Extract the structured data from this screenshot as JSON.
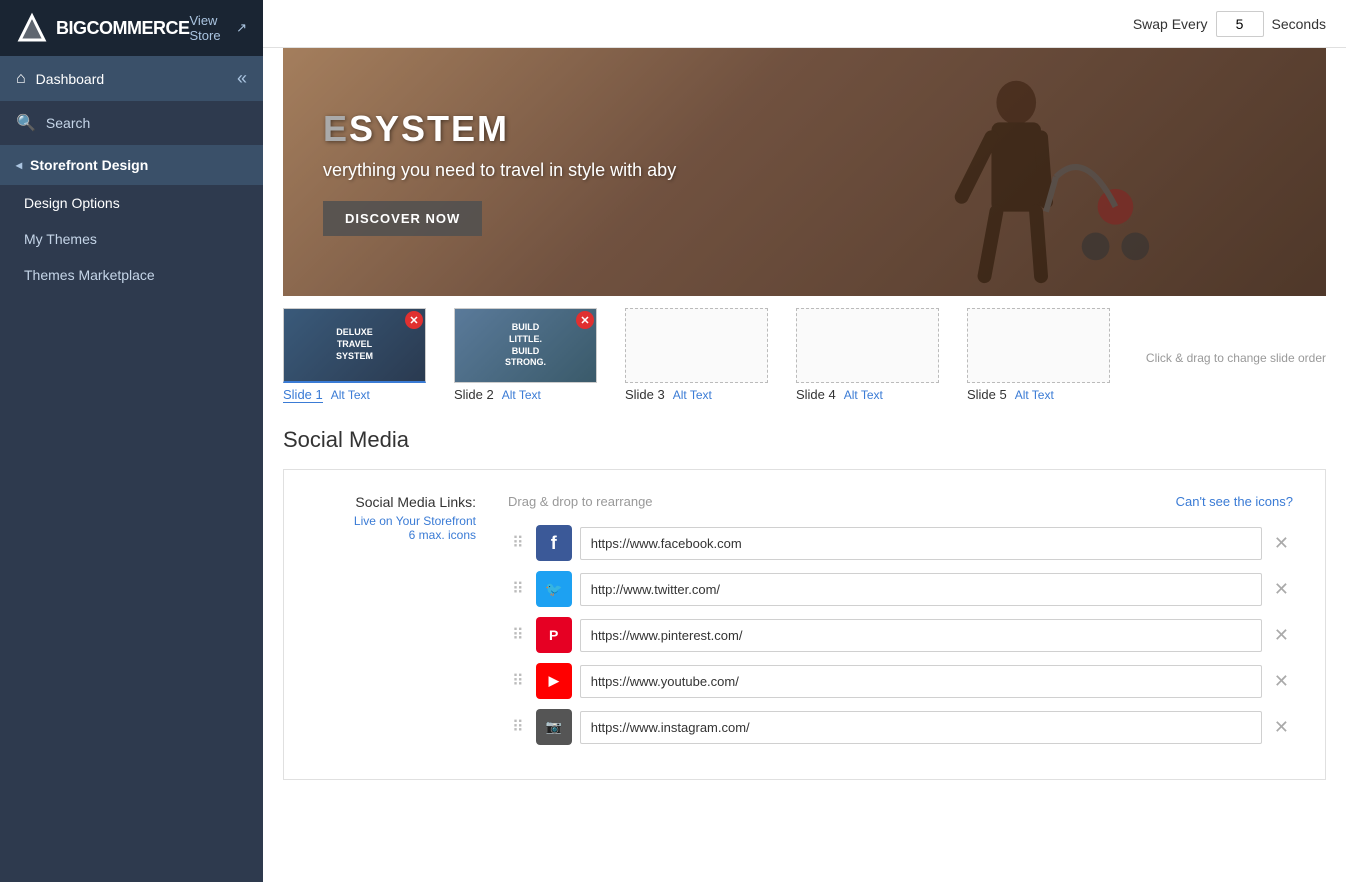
{
  "sidebar": {
    "logo": "BIGCOMMERCE",
    "view_store": "View Store",
    "nav_items": [
      {
        "id": "dashboard",
        "label": "Dashboard",
        "icon": "⌂",
        "active": true
      },
      {
        "id": "search",
        "label": "Search",
        "icon": "🔍",
        "active": false
      }
    ],
    "storefront_design": {
      "label": "Storefront Design",
      "sub_items": [
        {
          "id": "design-options",
          "label": "Design Options",
          "active": true
        },
        {
          "id": "my-themes",
          "label": "My Themes",
          "active": false
        },
        {
          "id": "themes-marketplace",
          "label": "Themes Marketplace",
          "active": false
        }
      ]
    }
  },
  "top_bar": {
    "swap_every_label": "Swap Every",
    "swap_value": "5",
    "seconds_label": "Seconds"
  },
  "slideshow": {
    "hero": {
      "title": "SYSTEM",
      "subtitle": "verything you need to travel in style with aby",
      "button_label": "DISCOVER NOW"
    },
    "drag_hint": "Click & drag to change slide order",
    "slides": [
      {
        "id": 1,
        "label": "Slide 1",
        "alt_text": "Alt Text",
        "active": true,
        "has_image": true,
        "thumb_text": "DELUXE\nTRAVEL\nSYSTEM"
      },
      {
        "id": 2,
        "label": "Slide 2",
        "alt_text": "Alt Text",
        "active": false,
        "has_image": true,
        "thumb_text": "BUILD\nLITTLE.\nBUILD\nSTRONG."
      },
      {
        "id": 3,
        "label": "Slide 3",
        "alt_text": "Alt Text",
        "active": false,
        "has_image": false
      },
      {
        "id": 4,
        "label": "Slide 4",
        "alt_text": "Alt Text",
        "active": false,
        "has_image": false
      },
      {
        "id": 5,
        "label": "Slide 5",
        "alt_text": "Alt Text",
        "active": false,
        "has_image": false
      }
    ]
  },
  "social_media": {
    "section_title": "Social Media",
    "links_label": "Social Media Links:",
    "live_label": "Live on Your Storefront",
    "max_label": "6 max. icons",
    "drag_hint": "Drag & drop to rearrange",
    "cant_see": "Can't see the icons?",
    "items": [
      {
        "id": "facebook",
        "platform": "facebook",
        "icon_char": "f",
        "url": "https://www.facebook.com",
        "color": "#3b5998"
      },
      {
        "id": "twitter",
        "platform": "twitter",
        "icon_char": "t",
        "url": "http://www.twitter.com/",
        "color": "#1da1f2"
      },
      {
        "id": "pinterest",
        "platform": "pinterest",
        "icon_char": "P",
        "url": "https://www.pinterest.com/",
        "color": "#e60023"
      },
      {
        "id": "youtube",
        "platform": "youtube",
        "icon_char": "▶",
        "url": "https://www.youtube.com/",
        "color": "#ff0000"
      },
      {
        "id": "instagram",
        "platform": "instagram",
        "icon_char": "◙",
        "url": "https://www.instagram.com/",
        "color": "#555555"
      }
    ]
  }
}
